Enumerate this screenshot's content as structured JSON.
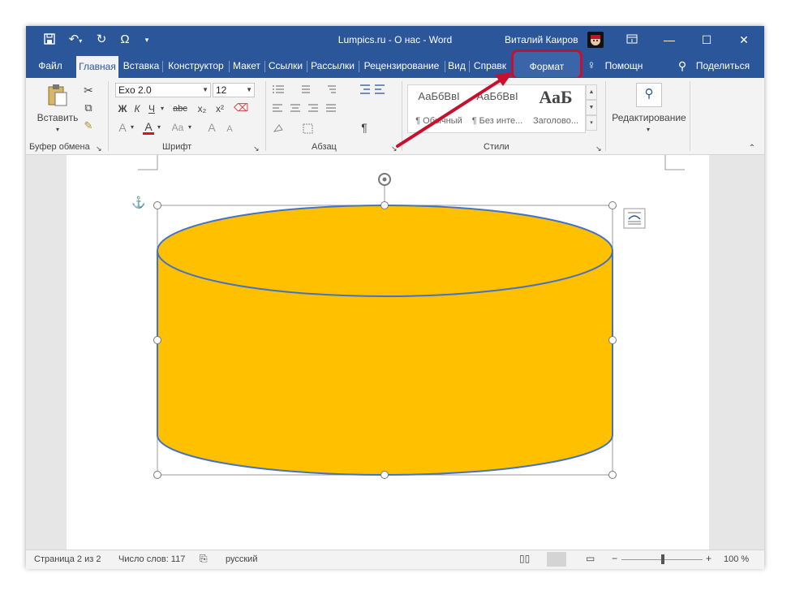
{
  "app": {
    "title": "Lumpics.ru - О нас  -  Word",
    "user": "Виталий Каиров"
  },
  "quick_access": {
    "save_icon": "save-icon",
    "undo_icon": "undo-icon",
    "redo_icon": "redo-icon",
    "omega_icon": "omega-icon",
    "customize_icon": "customize-icon"
  },
  "window_controls": {
    "ribbon_options": "ribbon-display-options-icon",
    "minimize": "minimize-icon",
    "maximize": "maximize-icon",
    "close": "close-icon"
  },
  "tabs": [
    {
      "label": "Файл"
    },
    {
      "label": "Главная"
    },
    {
      "label": "Вставка"
    },
    {
      "label": "Конструктор"
    },
    {
      "label": "Макет"
    },
    {
      "label": "Ссылки"
    },
    {
      "label": "Рассылки"
    },
    {
      "label": "Рецензирование"
    },
    {
      "label": "Вид"
    },
    {
      "label": "Справк"
    }
  ],
  "format_tab": "Формат",
  "help_tab": "Помощн",
  "share_label": "Поделиться",
  "ribbon": {
    "clipboard": {
      "paste_label": "Вставить",
      "group_label": "Буфер обмена"
    },
    "font": {
      "font_name": "Exo 2.0",
      "font_size": "12",
      "bold": "Ж",
      "italic": "К",
      "underline": "Ч",
      "strike": "abc",
      "subscript": "x₂",
      "superscript": "x²",
      "effects": "A",
      "color": "A",
      "change_case": "Aa",
      "grow": "A",
      "shrink": "A",
      "group_label": "Шрифт"
    },
    "paragraph": {
      "pilcrow": "¶",
      "group_label": "Абзац"
    },
    "styles": {
      "items": [
        {
          "preview": "АаБбВвІ",
          "caption": "¶ Обычный"
        },
        {
          "preview": "АаБбВвІ",
          "caption": "¶ Без инте..."
        },
        {
          "preview": "АаБ",
          "caption": "Заголово..."
        }
      ],
      "group_label": "Стили"
    },
    "editing": {
      "label": "Редактирование"
    }
  },
  "status": {
    "page": "Страница 2 из 2",
    "words": "Число слов: 117",
    "language": "русский",
    "zoom_minus": "−",
    "zoom_plus": "+",
    "zoom": "100 %",
    "zoom_level": 100
  },
  "colors": {
    "title_blue": "#2b579a",
    "shape_fill": "#ffc000",
    "shape_outline": "#4472c4",
    "highlight_red": "#c8102e"
  }
}
